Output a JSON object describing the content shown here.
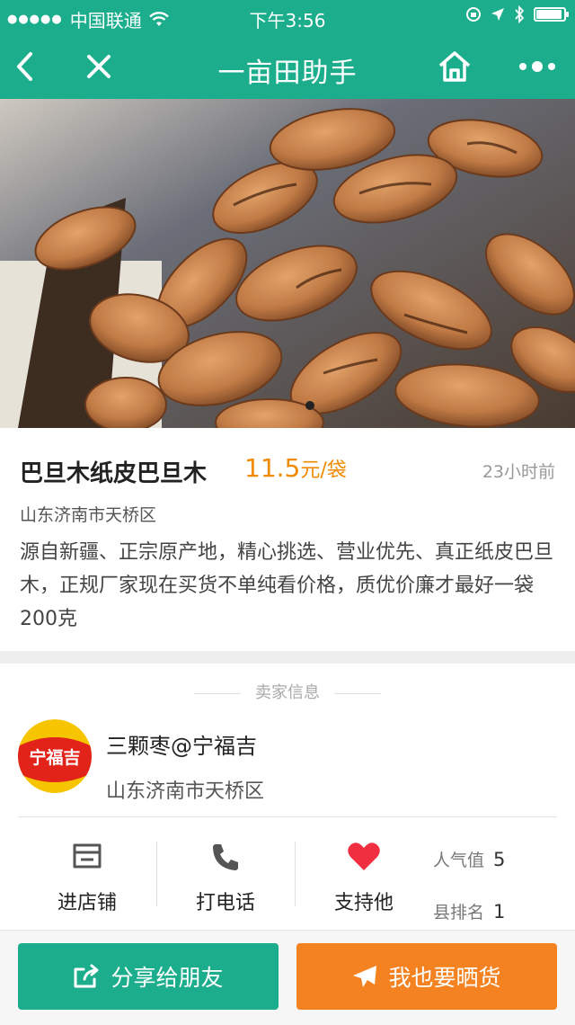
{
  "status_bar": {
    "carrier": "中国联通",
    "time": "下午3:56"
  },
  "nav": {
    "title": "一亩田助手",
    "back_icon": "back-arrow-icon",
    "close_icon": "close-icon",
    "home_icon": "home-icon",
    "more_icon": "more-icon"
  },
  "product": {
    "name": "巴旦木纸皮巴旦木",
    "price": "11.5",
    "unit": "元/袋",
    "posted": "23小时前",
    "location": "山东济南市天桥区",
    "description": "源自新疆、正宗原产地，精心挑选、营业优先、真正纸皮巴旦木，正规厂家现在买货不单纯看价格，质优价廉才最好一袋200克"
  },
  "seller": {
    "section_title": "卖家信息",
    "avatar_text": "宁福吉",
    "name": "三颗枣@宁福吉",
    "location": "山东济南市天桥区"
  },
  "actions": {
    "store": "进店铺",
    "call": "打电话",
    "support": "支持他"
  },
  "stats": {
    "popularity_label": "人气值",
    "popularity_value": "5",
    "rank_label": "县排名",
    "rank_value": "1"
  },
  "buttons": {
    "share": "分享给朋友",
    "post": "我也要晒货"
  },
  "colors": {
    "brand": "#1cae8c",
    "price": "#f08a00",
    "post_button": "#f48220",
    "heart": "#f03040"
  }
}
